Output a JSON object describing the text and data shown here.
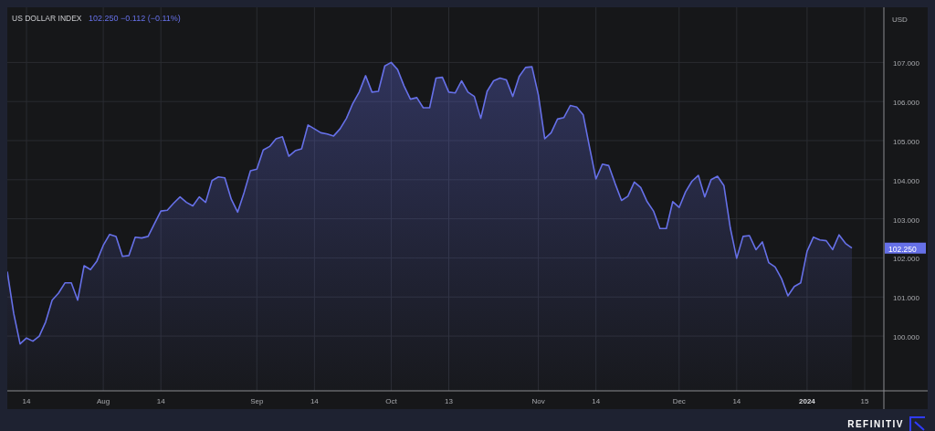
{
  "header": {
    "price": "102.250",
    "change": "−0.112 (−0.11%)"
  },
  "chart": {
    "last_price_label": "102.250",
    "chart_data": {
      "type": "area",
      "grid": true,
      "ylabel": "USD",
      "categories": [
        null,
        null,
        null,
        "14",
        null,
        null,
        null,
        null,
        null,
        null,
        null,
        null,
        null,
        null,
        null,
        "Aug",
        null,
        null,
        null,
        null,
        null,
        null,
        null,
        null,
        "14",
        null,
        null,
        null,
        null,
        null,
        null,
        null,
        null,
        null,
        null,
        null,
        null,
        null,
        null,
        "Sep",
        null,
        null,
        null,
        null,
        null,
        null,
        null,
        null,
        "14",
        null,
        null,
        null,
        null,
        null,
        null,
        null,
        null,
        null,
        null,
        null,
        "Oct",
        null,
        null,
        null,
        null,
        null,
        null,
        null,
        null,
        "13",
        null,
        null,
        null,
        null,
        null,
        null,
        null,
        null,
        null,
        null,
        null,
        null,
        null,
        "Nov",
        null,
        null,
        null,
        null,
        null,
        null,
        null,
        null,
        "14",
        null,
        null,
        null,
        null,
        null,
        null,
        null,
        null,
        null,
        null,
        null,
        null,
        "Dec",
        null,
        null,
        null,
        null,
        null,
        null,
        null,
        null,
        "14",
        null,
        null,
        null,
        null,
        null,
        null,
        null,
        null,
        null,
        null,
        "2024",
        null,
        null,
        null,
        null,
        null,
        null,
        null,
        null,
        "15",
        null,
        null
      ],
      "series": [
        {
          "name": "US DOLLAR INDEX",
          "color": "#6670e8",
          "values": [
            101.65,
            100.58,
            99.8,
            99.95,
            99.87,
            100.0,
            100.36,
            100.92,
            101.1,
            101.36,
            101.36,
            100.92,
            101.8,
            101.7,
            101.92,
            102.32,
            102.6,
            102.55,
            102.04,
            102.06,
            102.53,
            102.51,
            102.55,
            102.88,
            103.2,
            103.22,
            103.4,
            103.56,
            103.42,
            103.33,
            103.56,
            103.42,
            103.98,
            104.07,
            104.05,
            103.5,
            103.17,
            103.67,
            104.23,
            104.27,
            104.76,
            104.85,
            105.05,
            105.1,
            104.6,
            104.74,
            104.79,
            105.4,
            105.3,
            105.2,
            105.17,
            105.12,
            105.3,
            105.57,
            105.95,
            106.24,
            106.66,
            106.24,
            106.26,
            106.91,
            107.0,
            106.82,
            106.4,
            106.06,
            106.1,
            105.84,
            105.84,
            106.6,
            106.62,
            106.24,
            106.22,
            106.53,
            106.24,
            106.13,
            105.57,
            106.26,
            106.53,
            106.6,
            106.55,
            106.13,
            106.64,
            106.87,
            106.89,
            106.17,
            105.05,
            105.2,
            105.55,
            105.59,
            105.9,
            105.86,
            105.66,
            104.83,
            104.02,
            104.4,
            104.36,
            103.9,
            103.47,
            103.58,
            103.94,
            103.8,
            103.44,
            103.2,
            102.75,
            102.75,
            103.44,
            103.29,
            103.69,
            103.96,
            104.11,
            103.56,
            104.0,
            104.09,
            103.85,
            102.77,
            101.99,
            102.55,
            102.57,
            102.21,
            102.41,
            101.88,
            101.77,
            101.47,
            101.03,
            101.27,
            101.36,
            102.17,
            102.53,
            102.46,
            102.44,
            102.21,
            102.59,
            102.37,
            102.25,
            null,
            null,
            null,
            null
          ]
        }
      ],
      "ylim": [
        98.6,
        108.41
      ],
      "yticks": [
        {
          "value": 100,
          "label": "100.000"
        },
        {
          "value": 101,
          "label": "101.000"
        },
        {
          "value": 102,
          "label": "102.000"
        },
        {
          "value": 103,
          "label": "103.000"
        },
        {
          "value": 104,
          "label": "104.000"
        },
        {
          "value": 105,
          "label": "105.000"
        },
        {
          "value": 106,
          "label": "106.000"
        },
        {
          "value": 107,
          "label": "107.000"
        }
      ]
    }
  },
  "footer": {
    "brand": "REFINITIV"
  }
}
